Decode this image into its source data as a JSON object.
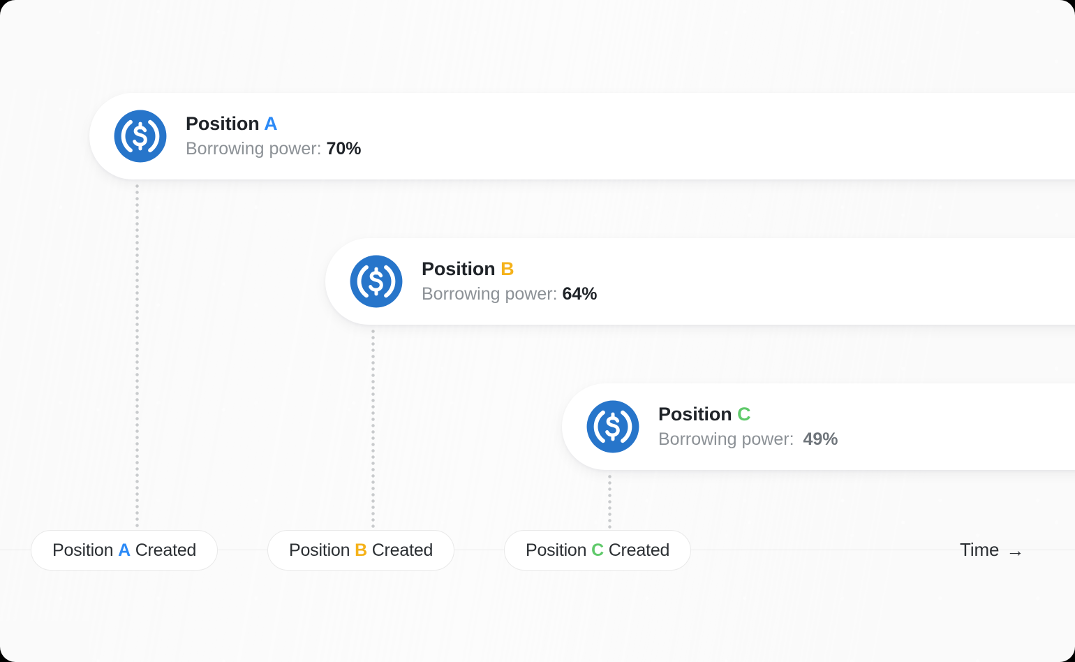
{
  "theme": {
    "page_background": "#FAFAFA",
    "card_background": "#FFFFFF",
    "text_primary": "#1F2328",
    "text_muted": "#8C9196",
    "border": "#E9E9E9",
    "connector": "#C9CBCD",
    "coin_blue": "#2775CA"
  },
  "accents": {
    "a": "#2B8AF7",
    "b": "#F5B21A",
    "c": "#5FC96A"
  },
  "cards": [
    {
      "id": "a",
      "icon": "usdc-coin-icon",
      "title_prefix": "Position",
      "title_accent": "A",
      "sub_label": "Borrowing power:",
      "sub_value": "70%",
      "accent_color": "#2B8AF7"
    },
    {
      "id": "b",
      "icon": "usdc-coin-icon",
      "title_prefix": "Position",
      "title_accent": "B",
      "sub_label": "Borrowing power:",
      "sub_value": "64%",
      "accent_color": "#F5B21A"
    },
    {
      "id": "c",
      "icon": "usdc-coin-icon",
      "title_prefix": "Position",
      "title_accent": "C",
      "sub_label": "Borrowing power:",
      "sub_value": "49%",
      "accent_color": "#5FC96A"
    }
  ],
  "events": [
    {
      "id": "a",
      "prefix": "Position",
      "accent": "A",
      "suffix": "Created",
      "accent_color": "#2B8AF7"
    },
    {
      "id": "b",
      "prefix": "Position",
      "accent": "B",
      "suffix": "Created",
      "accent_color": "#F5B21A"
    },
    {
      "id": "c",
      "prefix": "Position",
      "accent": "C",
      "suffix": "Created",
      "accent_color": "#5FC96A"
    }
  ],
  "axis": {
    "label": "Time",
    "arrow": "→"
  }
}
